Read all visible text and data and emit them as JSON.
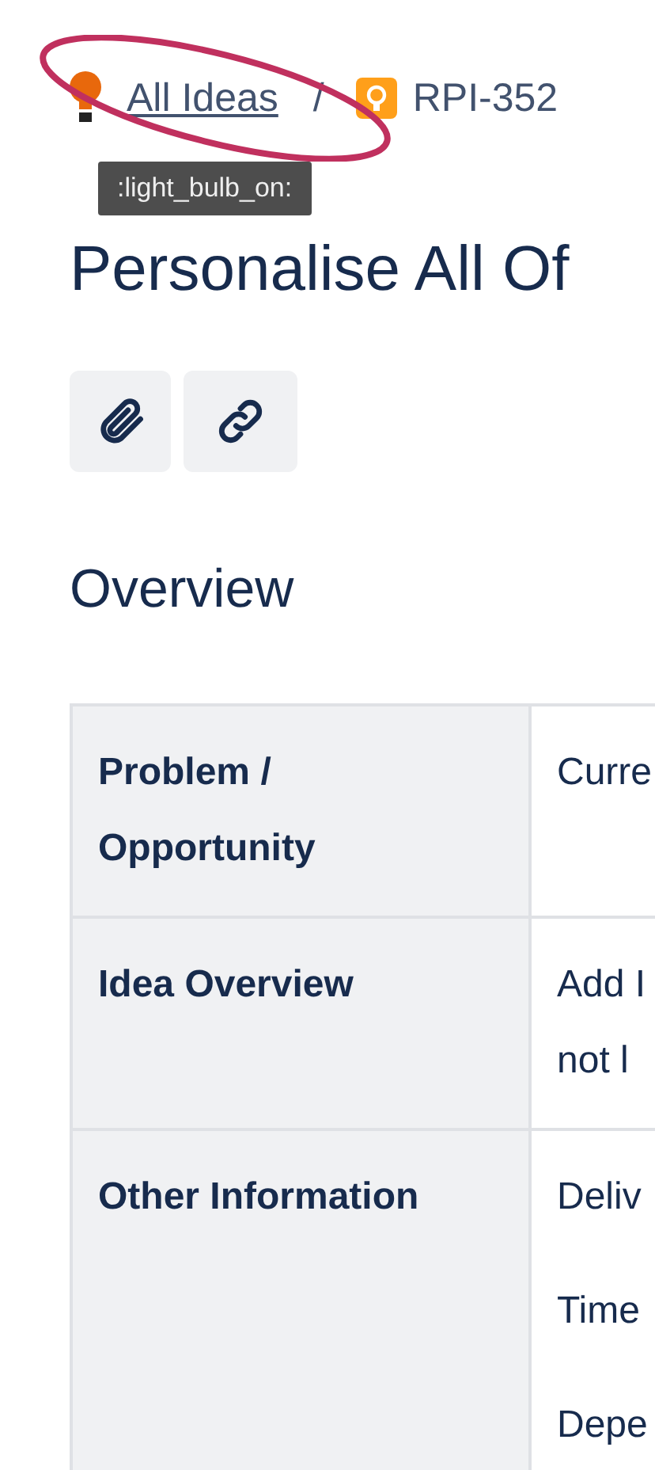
{
  "breadcrumb": {
    "parent": "All Ideas",
    "separator": "/",
    "current": "RPI-352"
  },
  "tooltip": ":light_bulb_on:",
  "title": "Personalise All Of",
  "section_heading": "Overview",
  "table": {
    "rows": [
      {
        "label": "Problem / Opportunity",
        "paragraphs": [
          [
            "Curre"
          ]
        ]
      },
      {
        "label": "Idea Overview",
        "paragraphs": [
          [
            "Add I",
            "not l"
          ]
        ]
      },
      {
        "label": "Other Information",
        "paragraphs": [
          [
            "Deliv"
          ],
          [
            "Time"
          ],
          [
            "Depe"
          ]
        ]
      }
    ]
  }
}
